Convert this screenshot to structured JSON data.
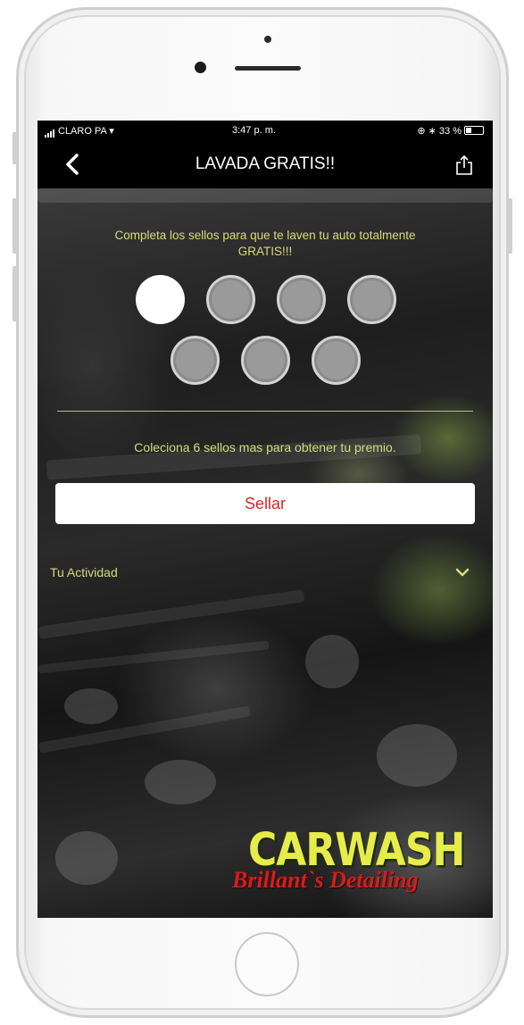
{
  "status_bar": {
    "carrier": "CLARO PA",
    "time": "3:47 p. m.",
    "battery": "33 %"
  },
  "nav": {
    "title": "LAVADA GRATIS!!",
    "back_icon": "chevron-left-icon",
    "share_icon": "share-icon"
  },
  "card": {
    "instruction": "Completa los sellos para que te laven tu auto totalmente GRATIS!!!",
    "stamps": {
      "total": 7,
      "filled": 1
    },
    "collect_message": "Coleciona 6 sellos mas para obtener tu premio.",
    "seal_button_label": "Sellar"
  },
  "activity": {
    "label": "Tu Actividad",
    "icon": "chevron-down-icon"
  },
  "logo": {
    "main": "CARWASH",
    "sub": "Brillant`s Detailing"
  },
  "colors": {
    "accent_text": "#d8dc7a",
    "button_text": "#d82828",
    "logo_yellow": "#e6ec4a",
    "logo_red": "#d41e1e"
  }
}
